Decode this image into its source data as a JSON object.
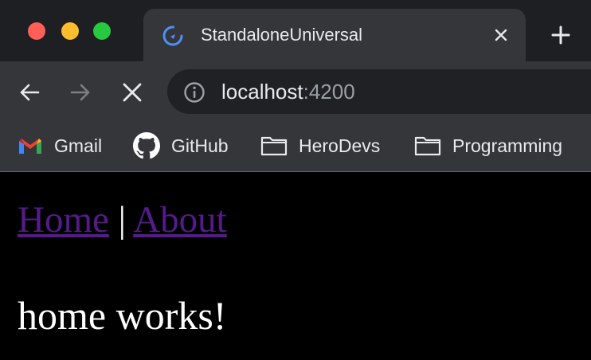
{
  "window": {
    "controls": {
      "close_color": "#ff5f57",
      "minimize_color": "#febc2e",
      "maximize_color": "#28c840"
    }
  },
  "tab": {
    "title": "StandaloneUniversal",
    "favicon": "angular-loading-icon",
    "close_icon": "close-icon"
  },
  "new_tab_icon": "plus-icon",
  "toolbar": {
    "back_icon": "arrow-left-icon",
    "forward_icon": "arrow-right-icon",
    "stop_icon": "close-icon",
    "url_host": "localhost",
    "url_port": ":4200",
    "info_icon": "info-icon"
  },
  "bookmarks": [
    {
      "label": "Gmail",
      "icon": "gmail-icon"
    },
    {
      "label": "GitHub",
      "icon": "github-icon"
    },
    {
      "label": "HeroDevs",
      "icon": "folder-icon"
    },
    {
      "label": "Programming",
      "icon": "folder-icon"
    }
  ],
  "page": {
    "nav": {
      "home": "Home",
      "separator": "|",
      "about": "About"
    },
    "heading": "home works!",
    "link_color": "#551a8b",
    "background": "#000000"
  }
}
